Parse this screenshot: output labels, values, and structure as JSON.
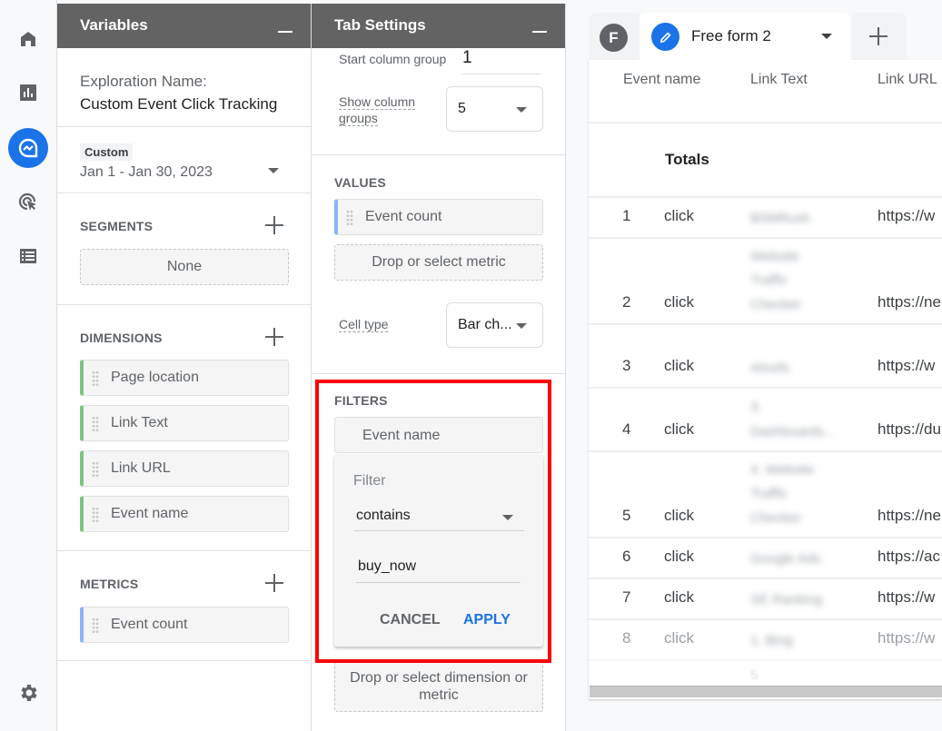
{
  "nav": {
    "items": [
      {
        "name": "home",
        "icon": "home-icon"
      },
      {
        "name": "reports",
        "icon": "bar-chart-icon"
      },
      {
        "name": "explore",
        "icon": "explore-icon",
        "active": true
      },
      {
        "name": "advertising",
        "icon": "target-cursor-icon"
      },
      {
        "name": "configure",
        "icon": "list-icon"
      }
    ],
    "settings_icon": "gear-icon"
  },
  "variables": {
    "title": "Variables",
    "exploration_label": "Exploration Name:",
    "exploration_name": "Custom Event Click Tracking",
    "date_badge": "Custom",
    "date_range": "Jan 1 - Jan 30, 2023",
    "segments": {
      "title": "SEGMENTS",
      "empty": "None"
    },
    "dimensions": {
      "title": "DIMENSIONS",
      "items": [
        "Page location",
        "Link Text",
        "Link URL",
        "Event name"
      ]
    },
    "metrics": {
      "title": "METRICS",
      "items": [
        "Event count"
      ]
    }
  },
  "tab_settings": {
    "title": "Tab Settings",
    "start_column_group_label": "Start column group",
    "start_column_group_value": "1",
    "show_column_groups_label_1": "Show column",
    "show_column_groups_label_2": "groups",
    "show_column_groups_value": "5",
    "values": {
      "title": "VALUES",
      "items": [
        "Event count"
      ],
      "drop_label": "Drop or select metric"
    },
    "cell_type_label": "Cell type",
    "cell_type_value": "Bar ch...",
    "filters": {
      "title": "FILTERS",
      "item": "Event name",
      "popup": {
        "label": "Filter",
        "condition": "contains",
        "value": "buy_now",
        "cancel": "CANCEL",
        "apply": "APPLY"
      },
      "drop_label": "Drop or select dimension or metric"
    }
  },
  "tabs": {
    "f_label": "F",
    "active_tab": "Free form 2"
  },
  "table": {
    "columns": [
      "Event name",
      "Link Text",
      "Link URL"
    ],
    "totals_label": "Totals",
    "rows": [
      {
        "index": "1",
        "event": "click",
        "link_text": [
          "$SMRush"
        ],
        "url": "https://w"
      },
      {
        "index": "2",
        "event": "click",
        "link_text": [
          "Website",
          "Traffic",
          "Checker"
        ],
        "url": "https://ne"
      },
      {
        "index": "3",
        "event": "click",
        "link_text": [
          "Ahrefs"
        ],
        "url": "https://w"
      },
      {
        "index": "4",
        "event": "click",
        "link_text": [
          "3.",
          "Dashboards..."
        ],
        "url": "https://du"
      },
      {
        "index": "5",
        "event": "click",
        "link_text": [
          "4. Website",
          "Traffic",
          "Checker"
        ],
        "url": "https://ne"
      },
      {
        "index": "6",
        "event": "click",
        "link_text": [
          "Google Ads"
        ],
        "url": "https://ac"
      },
      {
        "index": "7",
        "event": "click",
        "link_text": [
          "SE Ranking"
        ],
        "url": "https://w"
      },
      {
        "index": "8",
        "event": "click",
        "link_text": [
          "1. Bing"
        ],
        "url": "https://w"
      }
    ],
    "partial_row_text": "5"
  },
  "colors": {
    "accent": "#1a73e8",
    "header_bg": "#636363",
    "dimension_bar": "#7cc47f",
    "metric_bar": "#8ab4f8",
    "highlight_box": "#ff0000"
  }
}
